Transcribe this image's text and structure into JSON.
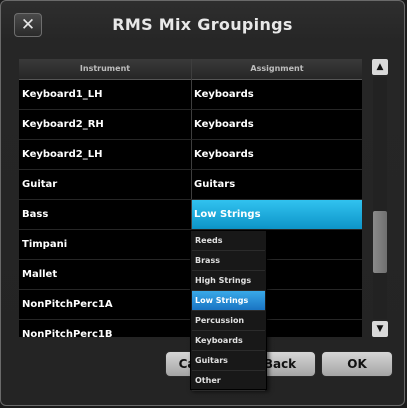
{
  "window": {
    "title": "RMS Mix Groupings",
    "close_glyph": "✕"
  },
  "table": {
    "headers": {
      "instrument": "Instrument",
      "assignment": "Assignment"
    },
    "rows": [
      {
        "instrument": "Keyboard1_LH",
        "assignment": "Keyboards"
      },
      {
        "instrument": "Keyboard2_RH",
        "assignment": "Keyboards"
      },
      {
        "instrument": "Keyboard2_LH",
        "assignment": "Keyboards"
      },
      {
        "instrument": "Guitar",
        "assignment": "Guitars"
      },
      {
        "instrument": "Bass",
        "assignment": "Low Strings"
      },
      {
        "instrument": "Timpani",
        "assignment": ""
      },
      {
        "instrument": "Mallet",
        "assignment": ""
      },
      {
        "instrument": "NonPitchPerc1A",
        "assignment": ""
      },
      {
        "instrument": "NonPitchPerc1B",
        "assignment": ""
      }
    ],
    "selected_row_index": 4
  },
  "dropdown": {
    "options": [
      "Reeds",
      "Brass",
      "High Strings",
      "Low Strings",
      "Percussion",
      "Keyboards",
      "Guitars",
      "Other"
    ],
    "selected": "Low Strings"
  },
  "scrollbar": {
    "up_glyph": "▲",
    "down_glyph": "▼"
  },
  "buttons": {
    "cancel": "Cancel",
    "back": "Back",
    "ok": "OK"
  },
  "colors": {
    "selection": "#1aa8dc",
    "background": "#000000"
  }
}
